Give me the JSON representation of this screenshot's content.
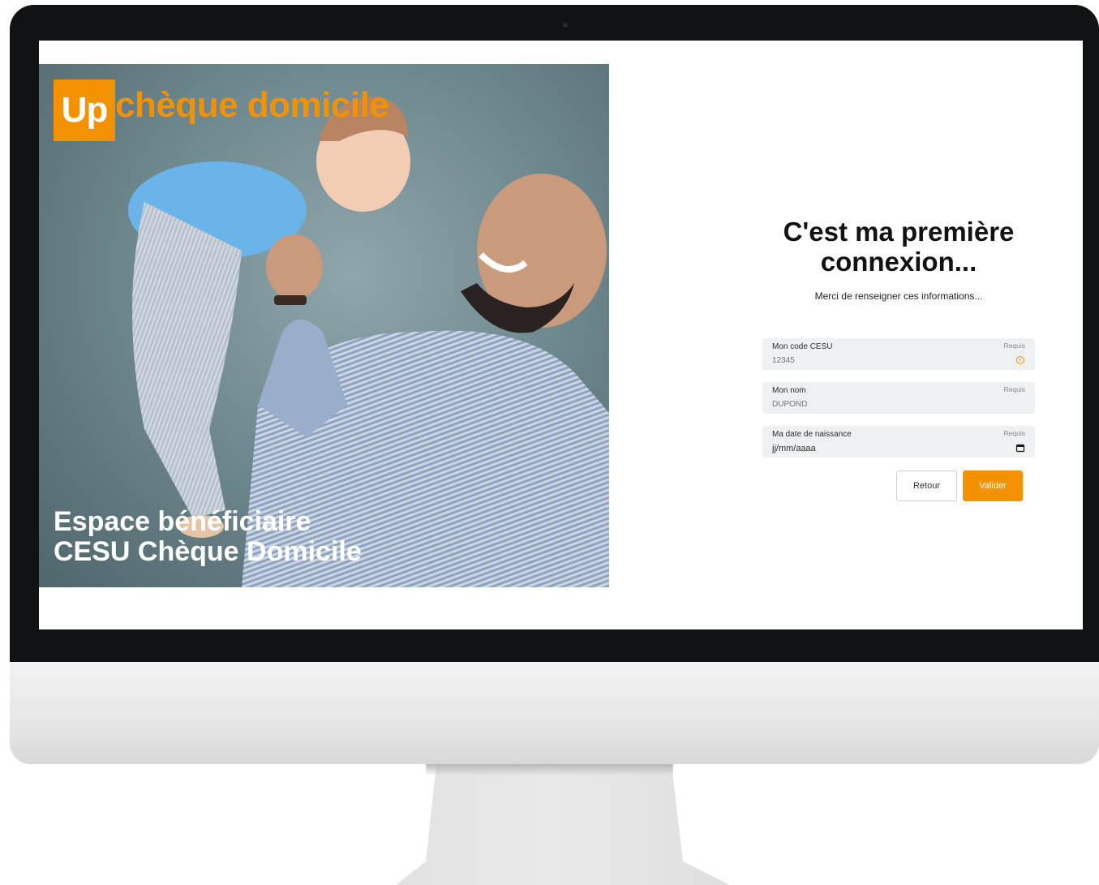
{
  "brand": {
    "logo_mark": "Up",
    "logo_text": "chèque domicile",
    "accent_color": "#f39200"
  },
  "hero": {
    "title_line1": "Espace bénéficiaire",
    "title_line2": "CESU Chèque Domicile"
  },
  "form": {
    "title": "C'est ma première connexion...",
    "subtitle": "Merci de renseigner ces informations...",
    "fields": [
      {
        "label": "Mon code CESU",
        "required": "Requis",
        "placeholder": "12345",
        "icon": "info-circle-icon"
      },
      {
        "label": "Mon nom",
        "required": "Requis",
        "placeholder": "DUPOND"
      },
      {
        "label": "Ma date de naissance",
        "required": "Requis",
        "placeholder": "jj/mm/aaaa",
        "icon": "calendar-icon"
      }
    ],
    "buttons": {
      "back": "Retour",
      "submit": "Valider"
    }
  }
}
